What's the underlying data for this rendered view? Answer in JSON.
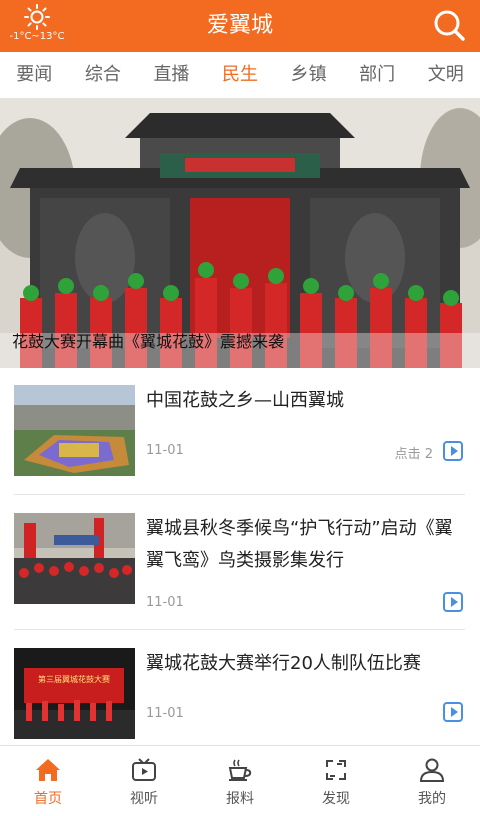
{
  "header": {
    "title": "爱翼城",
    "weather": {
      "icon": "sun-icon",
      "temperature": "-1°C~13°C"
    },
    "search_icon": "search-icon"
  },
  "tabs": [
    {
      "label": "要闻",
      "active": false
    },
    {
      "label": "综合",
      "active": false
    },
    {
      "label": "直播",
      "active": false
    },
    {
      "label": "民生",
      "active": true
    },
    {
      "label": "乡镇",
      "active": false
    },
    {
      "label": "部门",
      "active": false
    },
    {
      "label": "文明",
      "active": false
    }
  ],
  "banner": {
    "caption": "花鼓大赛开幕曲《翼城花鼓》震撼来袭"
  },
  "news": [
    {
      "title": "中国花鼓之乡—山西翼城",
      "date": "11-01",
      "clicks": "点击 2"
    },
    {
      "title": "翼城县秋冬季候鸟“护飞行动”启动《翼翼飞鸾》鸟类摄影集发行",
      "date": "11-01",
      "clicks": ""
    },
    {
      "title": "翼城花鼓大赛举行20人制队伍比赛",
      "date": "11-01",
      "clicks": ""
    }
  ],
  "thumb3_banner_text": "第三届翼城花鼓大赛",
  "bottom_nav": [
    {
      "label": "首页",
      "icon": "home-icon",
      "active": true
    },
    {
      "label": "视听",
      "icon": "tv-icon",
      "active": false
    },
    {
      "label": "报料",
      "icon": "coffee-cup-icon",
      "active": false
    },
    {
      "label": "发现",
      "icon": "discover-icon",
      "active": false
    },
    {
      "label": "我的",
      "icon": "user-icon",
      "active": false
    }
  ],
  "colors": {
    "accent": "#f26b21",
    "link_blue": "#4a90e2"
  }
}
